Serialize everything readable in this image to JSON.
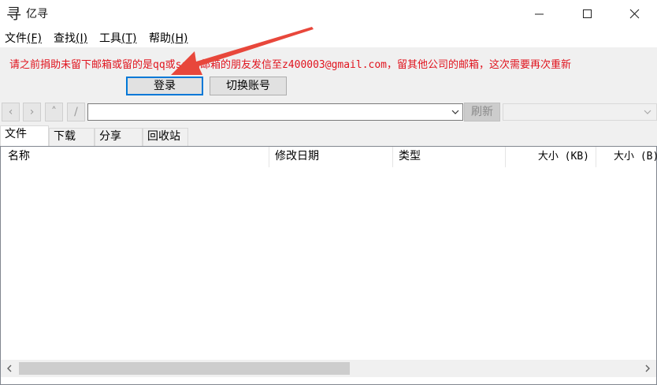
{
  "window": {
    "app_icon": "kanji-logo-icon",
    "icon_glyph": "寻",
    "title": "亿寻",
    "controls": [
      "minimize-icon",
      "maximize-icon",
      "close-icon"
    ]
  },
  "menubar": {
    "items": [
      {
        "label": "文件",
        "mnemonic": "(F)"
      },
      {
        "label": "查找",
        "mnemonic": "(I)"
      },
      {
        "label": "工具",
        "mnemonic": "(T)"
      },
      {
        "label": "帮助",
        "mnemonic": "(H)"
      }
    ]
  },
  "notice": {
    "text": "请之前捐助未留下邮箱或留的是qq或sohu邮箱的朋友发信至z400003@gmail.com，留其他公司的邮箱，这次需要再次重新",
    "color": "#e0141e"
  },
  "account": {
    "login_label": "登录",
    "switch_label": "切换账号"
  },
  "navbar": {
    "back_glyph": "‹",
    "forward_glyph": "›",
    "up_glyph": "˄",
    "root_glyph": "/",
    "path_value": "",
    "refresh_label": "刷新"
  },
  "tabs": [
    {
      "label": "文件",
      "active": true
    },
    {
      "label": "下载",
      "active": false
    },
    {
      "label": "分享",
      "active": false
    },
    {
      "label": "回收站",
      "active": false
    }
  ],
  "file_list": {
    "columns": [
      "名称",
      "修改日期",
      "类型",
      "大小 (KB)",
      "大小 (B)"
    ],
    "rows": []
  },
  "annotation": {
    "arrow_color": "#e8473b"
  }
}
